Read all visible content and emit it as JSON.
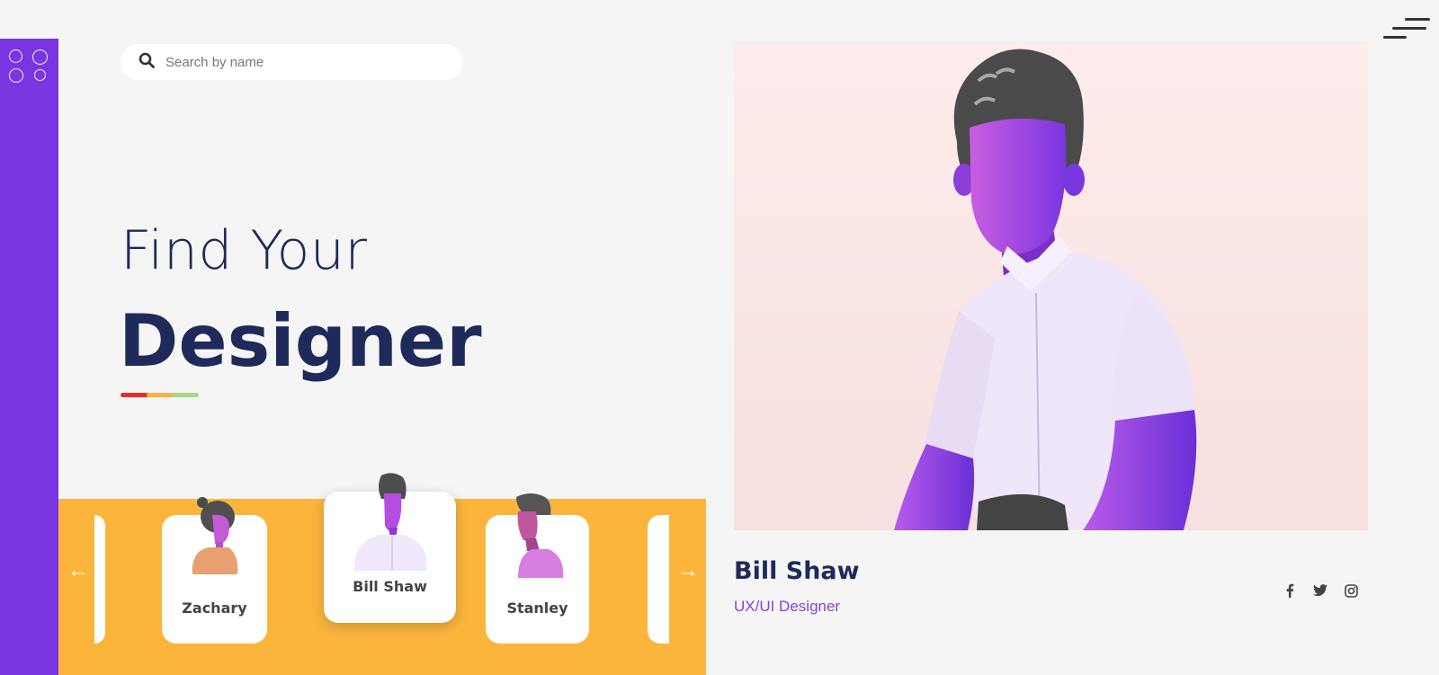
{
  "search": {
    "placeholder": "Search by name"
  },
  "hero": {
    "line1": "Find Your",
    "line2": "Designer"
  },
  "carousel": {
    "prev_arrow": "←",
    "next_arrow": "→",
    "cards": [
      {
        "name": "Zachary"
      },
      {
        "name": "Bill Shaw"
      },
      {
        "name": "Stanley"
      }
    ]
  },
  "profile": {
    "name": "Bill Shaw",
    "role": "UX/UI Designer"
  },
  "colors": {
    "sidebar": "#7b35e0",
    "carousel_bg": "#fbb53d",
    "heading": "#1e2a5a",
    "role_text": "#7b48d8",
    "accent_red": "#e5302a",
    "accent_orange": "#f7b347",
    "accent_green": "#a9d886"
  },
  "icons": [
    "grid-dots-icon",
    "search-icon",
    "menu-icon",
    "facebook-icon",
    "twitter-icon",
    "instagram-icon"
  ]
}
